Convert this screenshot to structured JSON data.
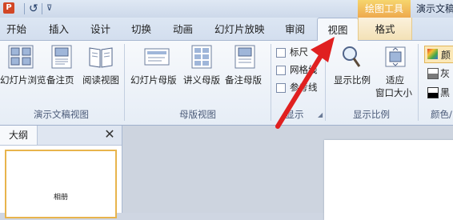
{
  "quick_access": {
    "logo": "P",
    "undo_icon": "↺",
    "more_icon": "⊽"
  },
  "context_tab": "绘图工具",
  "app_title": "演示文稿",
  "tabs": [
    {
      "label": "开始"
    },
    {
      "label": "插入"
    },
    {
      "label": "设计"
    },
    {
      "label": "切换"
    },
    {
      "label": "动画"
    },
    {
      "label": "幻灯片放映"
    },
    {
      "label": "审阅"
    },
    {
      "label": "视图"
    },
    {
      "label": "格式"
    }
  ],
  "active_tab": "视图",
  "groups": {
    "presentation_views": {
      "label": "演示文稿视图",
      "buttons": [
        "幻灯片浏览",
        "备注页",
        "阅读视图"
      ]
    },
    "master_views": {
      "label": "母版视图",
      "buttons": [
        "幻灯片母版",
        "讲义母版",
        "备注母版"
      ]
    },
    "show": {
      "label": "显示",
      "checkboxes": [
        {
          "label": "标尺",
          "checked": false
        },
        {
          "label": "网格线",
          "checked": false
        },
        {
          "label": "参考线",
          "checked": false
        }
      ]
    },
    "zoom": {
      "label": "显示比例",
      "buttons": [
        "显示比例",
        "适应",
        "窗口大小"
      ]
    },
    "color": {
      "label": "颜色/",
      "options": [
        "颜",
        "灰",
        "黑"
      ]
    }
  },
  "panel": {
    "tab_label": "大纲",
    "close_icon": "✕",
    "thumb_text": "相册"
  },
  "colors": {
    "accent_arrow": "#e02020",
    "context_tab": "#f0b04e"
  }
}
